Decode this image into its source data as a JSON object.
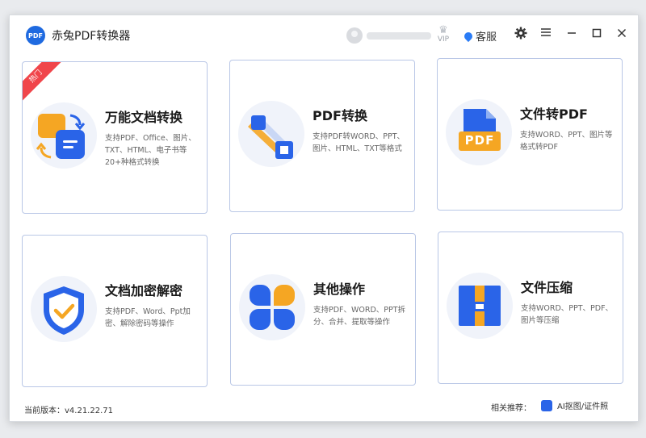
{
  "app": {
    "logo_text": "PDF",
    "title": "赤兔PDF转换器",
    "vip_label": "VIP",
    "service_label": "客服",
    "settings_icon": "gear-icon",
    "menu_icon": "menu-icon",
    "minimize_icon": "minimize-icon",
    "maximize_icon": "maximize-icon",
    "close_icon": "close-icon"
  },
  "cards": [
    {
      "title": "万能文档转换",
      "desc": "支持PDF、Office、图片、TXT、HTML、电子书等20+种格式转换",
      "badge": "热门",
      "icon": "convert-icon"
    },
    {
      "title": "PDF转换",
      "desc": "支持PDF转WORD、PPT、图片、HTML、TXT等格式",
      "icon": "pdf-convert-icon"
    },
    {
      "title": "文件转PDF",
      "desc": "支持WORD、PPT、图片等格式转PDF",
      "icon": "file-to-pdf-icon",
      "icon_text": "PDF"
    },
    {
      "title": "文档加密解密",
      "desc": "支持PDF、Word、Ppt加密、解除密码等操作",
      "icon": "shield-check-icon"
    },
    {
      "title": "其他操作",
      "desc": "支持PDF、WORD、PPT拆分、合并、提取等操作",
      "icon": "grid-petals-icon"
    },
    {
      "title": "文件压缩",
      "desc": "支持WORD、PPT、PDF、图片等压缩",
      "icon": "compress-icon"
    }
  ],
  "footer": {
    "version": "当前版本：v4.21.22.71",
    "recommend_label": "相关推荐：",
    "ai_link": "AI抠图/证件照"
  },
  "colors": {
    "brand": "#1f6ae0",
    "accent_blue": "#2a64e8",
    "hot_badge": "#f0454b",
    "orange": "#f5a623",
    "card_border": "#b9c7e6"
  }
}
